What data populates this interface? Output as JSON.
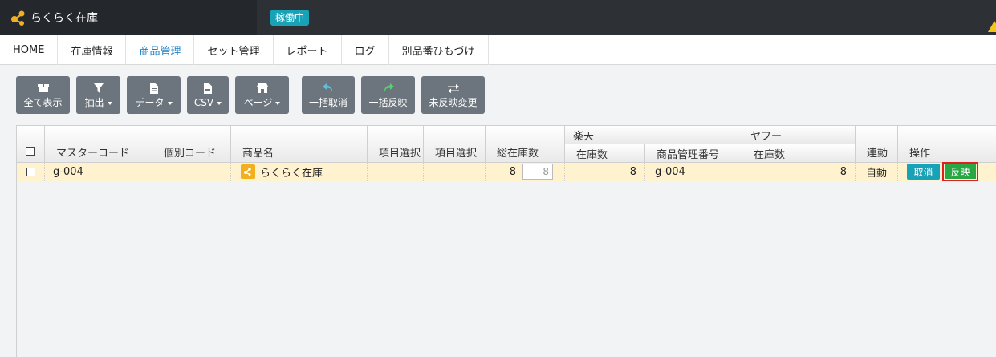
{
  "app": {
    "title": "らくらく在庫",
    "status": "稼働中"
  },
  "nav": [
    {
      "label": "HOME",
      "active": false
    },
    {
      "label": "在庫情報",
      "active": false
    },
    {
      "label": "商品管理",
      "active": true
    },
    {
      "label": "セット管理",
      "active": false
    },
    {
      "label": "レポート",
      "active": false
    },
    {
      "label": "ログ",
      "active": false
    },
    {
      "label": "別品番ひもづけ",
      "active": false
    }
  ],
  "toolbar": {
    "show_all": "全て表示",
    "extract": "抽出",
    "data": "データ",
    "csv": "CSV",
    "page": "ページ",
    "bulk_cancel": "一括取消",
    "bulk_apply": "一括反映",
    "unapplied_changes": "未反映変更"
  },
  "table": {
    "headers": {
      "master_code": "マスターコード",
      "individual_code": "個別コード",
      "product_name": "商品名",
      "item_select_1": "項目選択",
      "item_select_2": "項目選択",
      "total_stock": "総在庫数",
      "rakuten": "楽天",
      "rakuten_stock": "在庫数",
      "rakuten_mgmt_no": "商品管理番号",
      "yahoo": "ヤフー",
      "yahoo_stock": "在庫数",
      "link": "連動",
      "operation": "操作"
    },
    "row": {
      "master_code": "g-004",
      "individual_code": "",
      "product_name": "らくらく在庫",
      "item_select_1": "",
      "item_select_2": "",
      "total_stock": "8",
      "total_stock_input": "8",
      "rakuten_stock": "8",
      "rakuten_mgmt_no": "g-004",
      "yahoo_stock": "8",
      "link": "自動",
      "cancel_label": "取消",
      "apply_label": "反映"
    }
  },
  "colors": {
    "accent": "#17a2b8",
    "apply": "#28a745",
    "header_bg": "#2d3136",
    "row_highlight": "#fff3cf",
    "nav_active": "#1b7fc4"
  }
}
